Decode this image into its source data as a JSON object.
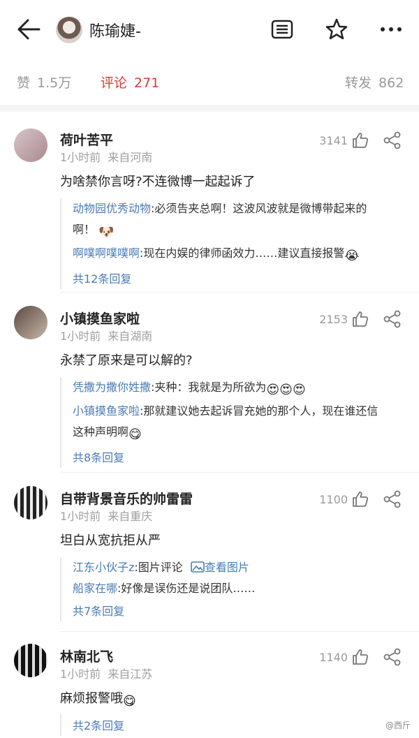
{
  "header": {
    "username": "陈瑜婕-",
    "back_icon": "arrow-left-icon",
    "icons": [
      "list-icon",
      "star-icon",
      "more-icon"
    ]
  },
  "stats": {
    "likes_label": "赞",
    "likes_count": "1.5万",
    "comments_label": "评论",
    "comments_count": "271",
    "reposts_label": "转发",
    "reposts_count": "862"
  },
  "comments": [
    {
      "name": "荷叶苦平",
      "time": "1小时前",
      "location": "来自河南",
      "likes": "3141",
      "text": "为啥禁你言呀?不连微博一起起诉了",
      "replies": [
        {
          "user": "动物园优秀动物",
          "text": ":必须告夹总啊！这波风波就是微博带起来的",
          "text2": "啊！"
        },
        {
          "user": "啊噗啊噗噗啊",
          "text": ":现在内娱的律师函效力……建议直接报警"
        }
      ],
      "more": "共12条回复"
    },
    {
      "name": "小镇摸鱼家啦",
      "time": "1小时前",
      "location": "来自湖南",
      "likes": "2153",
      "text": "永禁了原来是可以解的?",
      "replies": [
        {
          "user": "凭撒为撒你姓撒",
          "text": ":夹种：我就是为所欲为"
        },
        {
          "user": "小镇摸鱼家啦",
          "text": ":那就建议她去起诉冒充她的那个人，现在谁还信",
          "text2": "这种声明啊"
        }
      ],
      "more": "共8条回复"
    },
    {
      "name": "自带背景音乐的帅雷雷",
      "time": "1小时前",
      "location": "来自重庆",
      "likes": "1100",
      "text": "坦白从宽抗拒从严",
      "replies": [
        {
          "user": "江东小伙子z",
          "text": ":图片评论",
          "link": "查看图片"
        },
        {
          "user": "船家在哪",
          "text": ":好像是误伤还是说团队……"
        }
      ],
      "more": "共7条回复"
    },
    {
      "name": "林南北飞",
      "time": "1小时前",
      "location": "来自江苏",
      "likes": "1140",
      "text": "麻烦报警哦",
      "more": "共2条回复"
    }
  ],
  "watermark": "@西斤",
  "colors": {
    "accent_red": "#d43c33",
    "link_blue": "#4a7bb5",
    "muted": "#999999"
  }
}
